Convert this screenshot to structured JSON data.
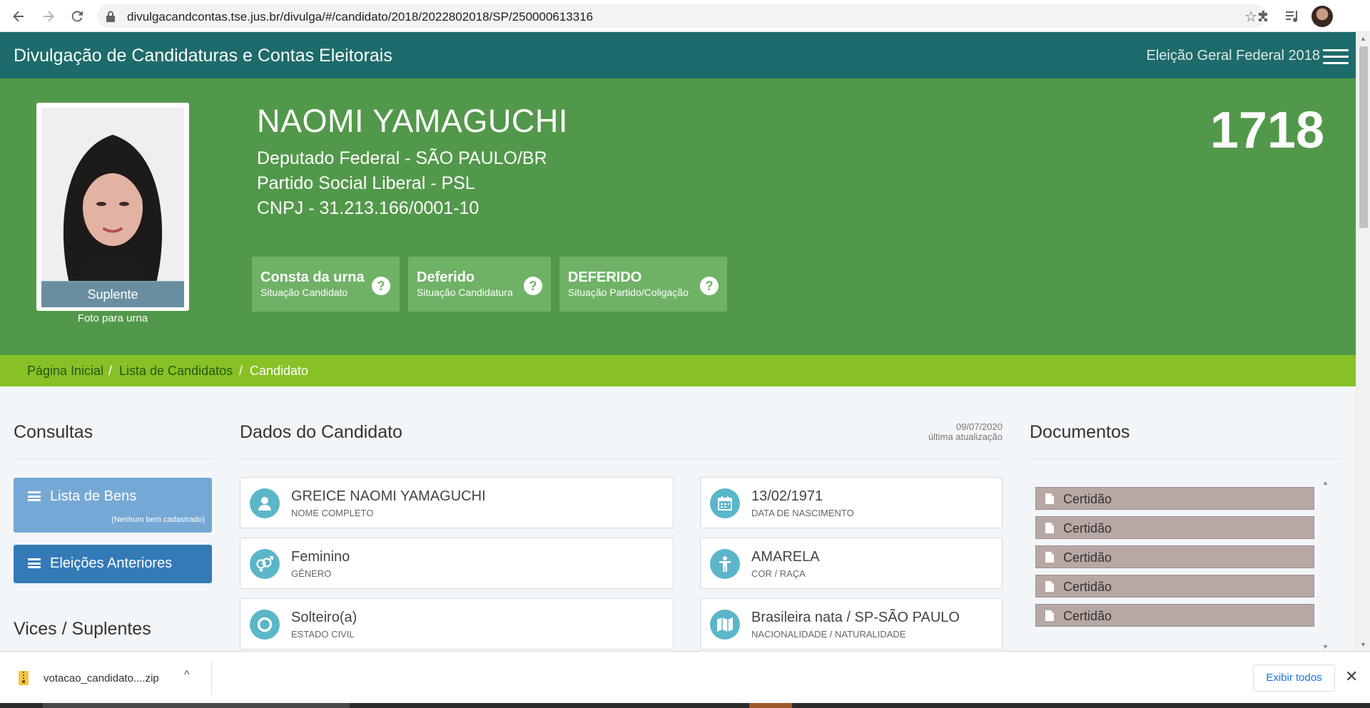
{
  "browser": {
    "url": "divulgacandcontas.tse.jus.br/divulga/#/candidato/2018/2022802018/SP/250000613316"
  },
  "header": {
    "title": "Divulgação de Candidaturas e Contas Eleitorais",
    "election": "Eleição Geral Federal 2018"
  },
  "candidate": {
    "name": "NAOMI YAMAGUCHI",
    "office": "Deputado Federal - SÃO PAULO/BR",
    "party": "Partido Social Liberal - PSL",
    "cnpj": "CNPJ - 31.213.166/0001-10",
    "number": "1718",
    "photo_badge": "Suplente",
    "photo_caption": "Foto para urna"
  },
  "status": [
    {
      "title": "Consta da urna",
      "subtitle": "Situação Candidato"
    },
    {
      "title": "Deferido",
      "subtitle": "Situação Candidatura"
    },
    {
      "title": "DEFERIDO",
      "subtitle": "Situação Partido/Coligação"
    }
  ],
  "breadcrumb": [
    "Página Inicial",
    "Lista de Candidatos",
    "Candidato"
  ],
  "consultas": {
    "heading": "Consultas",
    "bens_label": "Lista de Bens",
    "bens_note": "(Nenhum bem cadastrado)",
    "eleicoes_label": "Eleições Anteriores",
    "vices_heading": "Vices / Suplentes"
  },
  "dados": {
    "heading": "Dados do Candidato",
    "update_date": "09/07/2020",
    "update_label": "última atualização",
    "fields": [
      {
        "value": "GREICE NAOMI YAMAGUCHI",
        "caption": "NOME COMPLETO",
        "icon": "user-icon"
      },
      {
        "value": "13/02/1971",
        "caption": "DATA DE NASCIMENTO",
        "icon": "calendar-icon"
      },
      {
        "value": "Feminino",
        "caption": "GÊNERO",
        "icon": "gender-icon"
      },
      {
        "value": "AMARELA",
        "caption": "COR / RAÇA",
        "icon": "person-icon"
      },
      {
        "value": "Solteiro(a)",
        "caption": "ESTADO CIVIL",
        "icon": "ring-icon"
      },
      {
        "value": "Brasileira nata / SP-SÃO PAULO",
        "caption": "NACIONALIDADE / NATURALIDADE",
        "icon": "map-icon"
      }
    ]
  },
  "documentos": {
    "heading": "Documentos",
    "items": [
      "Certidão",
      "Certidão",
      "Certidão",
      "Certidão",
      "Certidão"
    ]
  },
  "download": {
    "file": "votacao_candidato....zip",
    "show_all": "Exibir todos"
  },
  "colors": {
    "header_teal": "#1d6b6a",
    "banner_green": "#52984a",
    "breadcrumb_lime": "#87c126",
    "btn_light_blue": "#75a8d5",
    "btn_blue": "#337ab7",
    "icon_cyan": "#5bb6c9",
    "doc_bg": "#b7a8a4"
  }
}
